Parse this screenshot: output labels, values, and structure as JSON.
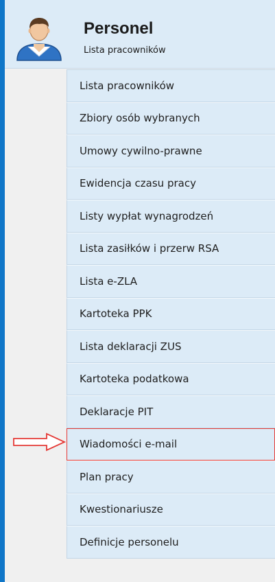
{
  "header": {
    "title": "Personel",
    "subtitle": "Lista pracowników",
    "icon": "person-icon"
  },
  "menu": {
    "items": [
      {
        "label": "Lista pracowników"
      },
      {
        "label": "Zbiory osób wybranych"
      },
      {
        "label": "Umowy cywilno-prawne"
      },
      {
        "label": "Ewidencja czasu pracy"
      },
      {
        "label": "Listy wypłat wynagrodzeń"
      },
      {
        "label": "Lista zasiłków i przerw RSA"
      },
      {
        "label": "Lista e-ZLA"
      },
      {
        "label": "Kartoteka PPK"
      },
      {
        "label": "Lista deklaracji ZUS"
      },
      {
        "label": "Kartoteka podatkowa"
      },
      {
        "label": "Deklaracje PIT"
      },
      {
        "label": "Wiadomości e-mail"
      },
      {
        "label": "Plan pracy"
      },
      {
        "label": "Kwestionariusze"
      },
      {
        "label": "Definicje personelu"
      }
    ],
    "highlighted_item": "Wiadomości e-mail"
  },
  "colors": {
    "accent_border": "#0f76c8",
    "item_background": "#dcebf7",
    "highlight": "#e53935"
  }
}
